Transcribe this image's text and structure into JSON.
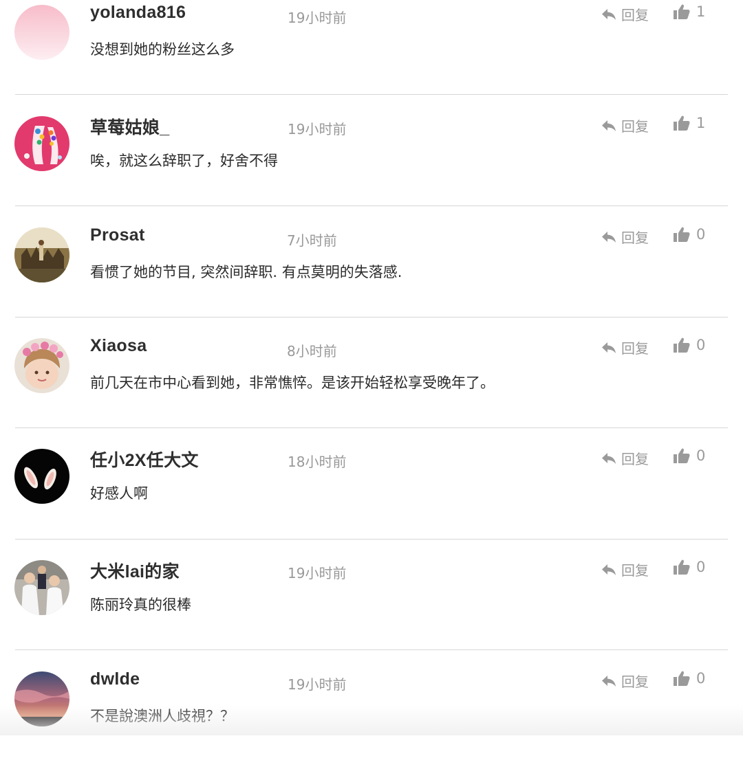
{
  "comments": [
    {
      "username": "yolanda816",
      "time": "19小时前",
      "text": "没想到她的粉丝这么多",
      "reply_label": "回复",
      "likes": "1",
      "avatar": "pink-gradient-avatar"
    },
    {
      "username": "草莓姑娘_",
      "time": "19小时前",
      "text": "唉，就这么辞职了，好舍不得",
      "reply_label": "回复",
      "likes": "1",
      "avatar": "candy-hands-avatar"
    },
    {
      "username": "Prosat",
      "time": "7小时前",
      "text": "看惯了她的节目, 突然间辞职. 有点莫明的失落感.",
      "reply_label": "回复",
      "likes": "0",
      "avatar": "painting-avatar"
    },
    {
      "username": "Xiaosa",
      "time": "8小时前",
      "text": "前几天在市中心看到她，非常憔悴。是该开始轻松享受晚年了。",
      "reply_label": "回复",
      "likes": "0",
      "avatar": "child-flower-crown-avatar"
    },
    {
      "username": "任小2X任大文",
      "time": "18小时前",
      "text": "好感人啊",
      "reply_label": "回复",
      "likes": "0",
      "avatar": "bunny-ears-avatar"
    },
    {
      "username": "大米lai的家",
      "time": "19小时前",
      "text": "陈丽玲真的很棒",
      "reply_label": "回复",
      "likes": "0",
      "avatar": "family-photo-avatar"
    },
    {
      "username": "dwlde",
      "time": "19小时前",
      "text": "不是說澳洲人歧視？？",
      "reply_label": "回复",
      "likes": "0",
      "avatar": "sunset-sky-avatar"
    }
  ],
  "colors": {
    "text": "#2b2b2b",
    "muted": "#999999",
    "separator": "#d6d6d6"
  }
}
